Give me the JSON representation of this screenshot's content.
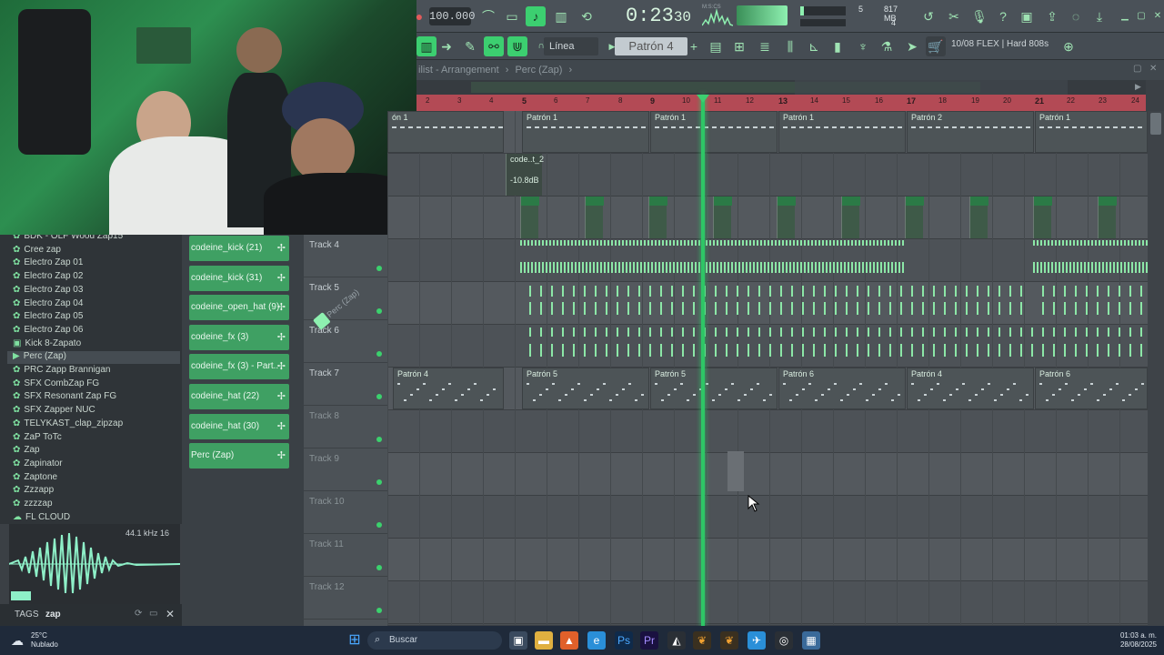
{
  "toolbar": {
    "tempo": "100.000",
    "time_main": "0:23",
    "time_sub": "30",
    "time_mode": "M:S:CS",
    "cpu_voices": "5",
    "memory": "817 MB",
    "voices_sub": "4",
    "snap_label": "Línea",
    "pattern_label": "Patrón 4",
    "hint_text": "10/08 FLEX | Hard 808s"
  },
  "playlist": {
    "title": "ilist - Arrangement",
    "breadcrumb": "Perc (Zap)",
    "ruler": [
      "2",
      "3",
      "4",
      "5",
      "6",
      "7",
      "8",
      "9",
      "10",
      "11",
      "12",
      "13",
      "14",
      "15",
      "16",
      "17",
      "18",
      "19",
      "20",
      "21",
      "22",
      "23",
      "24"
    ],
    "patron_row1": [
      "ón 1",
      "Patrón 1",
      "Patrón 1",
      "Patrón 1",
      "Patrón 2",
      "Patrón 1"
    ],
    "audio_clip_label": "code..t_2",
    "audio_clip_gain": "-10.8dB",
    "patron_row7": [
      "Patrón 4",
      "Patrón 5",
      "Patrón 5",
      "Patrón 6",
      "Patrón 4",
      "Patrón 6"
    ]
  },
  "tracks": [
    "Track 4",
    "Track 5",
    "Track 6",
    "Track 7",
    "Track 8",
    "Track 9",
    "Track 10",
    "Track 11",
    "Track 12"
  ],
  "overlay_label": "Perc (Zap)",
  "browser": {
    "items": [
      "BDK - OLF Wood Zap15",
      "Cree zap",
      "Electro Zap 01",
      "Electro Zap 02",
      "Electro Zap 03",
      "Electro Zap 04",
      "Electro Zap 05",
      "Electro Zap 06",
      "Kick 8-Zapato",
      "Perc (Zap)",
      "PRC Zapp Brannigan",
      "SFX CombZap FG",
      "SFX Resonant Zap FG",
      "SFX Zapper NUC",
      "TELYKAST_clap_zipzap",
      "ZaP ToTc",
      "Zap",
      "Zapinator",
      "Zaptone",
      "Zzzapp",
      "zzzzap",
      "FL CLOUD"
    ],
    "selected": "Perc (Zap)",
    "sample_info": "44.1 kHz 16",
    "tags_label": "TAGS",
    "tags_value": "zap"
  },
  "rack": [
    "codeine_kick (21)",
    "codeine_kick (31)",
    "codeine_open_hat (9)",
    "codeine_fx (3)",
    "codeine_fx (3) - Part..",
    "codeine_hat (22)",
    "codeine_hat (30)",
    "Perc (Zap)"
  ],
  "taskbar": {
    "temp": "25°C",
    "weather": "Nublado",
    "search": "Buscar",
    "time": "01:03 a. m.",
    "date": "28/08/2025"
  },
  "colors": {
    "accent": "#3ccf70",
    "ruler": "#b34a55",
    "playhead": "#2ec666"
  }
}
